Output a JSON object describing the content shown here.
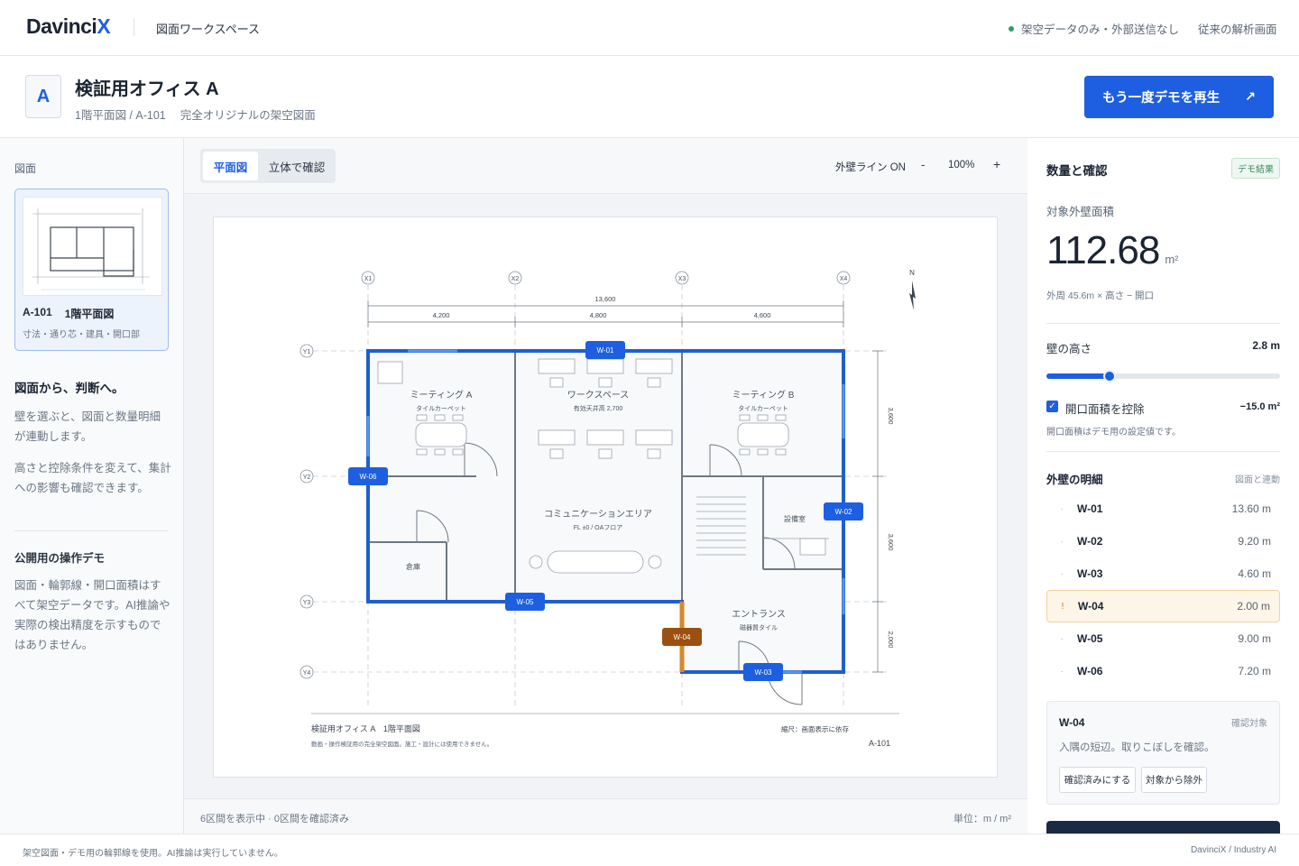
{
  "topbar": {
    "logo_main": "Davinci",
    "logo_accent": "X",
    "nav": "図面ワークスペース",
    "status": "架空データのみ・外部送信なし",
    "legacy_link": "従来の解析画面"
  },
  "header": {
    "icon_letter": "A",
    "title": "検証用オフィス A",
    "sheet": "1階平面図 / A-101",
    "note": "完全オリジナルの架空図面",
    "replay_button": "もう一度デモを再生",
    "replay_icon": "arrow-up-right-icon"
  },
  "left": {
    "section_label": "図面",
    "thumb": {
      "code": "A-101",
      "name": "1階平面図",
      "desc": "寸法・通り芯・建具・開口部"
    },
    "heading": "図面から、判断へ。",
    "para1": "壁を選ぶと、図面と数量明細が連動します。",
    "para2": "高さと控除条件を変えて、集計への影響も確認できます。",
    "heading2": "公開用の操作デモ",
    "para3": "図面・輪郭線・開口面積はすべて架空データです。AI推論や実際の検出精度を示すものではありません。"
  },
  "toolbar": {
    "tab_plan": "平面図",
    "tab_3d": "立体で確認",
    "wall_line": "外壁ライン ON",
    "zoom_minus": "-",
    "zoom": "100%",
    "zoom_plus": "+"
  },
  "drawing": {
    "grid_x": [
      "X1",
      "X2",
      "X3",
      "X4"
    ],
    "grid_y": [
      "Y1",
      "Y2",
      "Y3",
      "Y4"
    ],
    "dim_total": "13,600",
    "dims_x": [
      "4,200",
      "4,800",
      "4,600"
    ],
    "dims_y": [
      "3,600",
      "3,600",
      "2,000"
    ],
    "north": "N",
    "rooms": {
      "meeting_a": "ミーティング A",
      "meeting_a_sub": "タイルカーペット",
      "workspace": "ワークスペース",
      "workspace_sub": "有効天井高 2,700",
      "meeting_b": "ミーティング B",
      "meeting_b_sub": "タイルカーペット",
      "community": "コミュニケーションエリア",
      "community_sub": "FL ±0 / OAフロア",
      "equipment": "設備室",
      "storage": "倉庫",
      "entrance": "エントランス",
      "entrance_sub": "磁器質タイル"
    },
    "wall_tags": [
      "W-01",
      "W-02",
      "W-03",
      "W-04",
      "W-05",
      "W-06"
    ],
    "title_block": {
      "name": "検証用オフィス A　1階平面図",
      "disclaimer": "動画・操作検証用の完全架空図面。施工・設計には使用できません。",
      "scale": "縮尺：画面表示に依存",
      "sheet_no": "A-101"
    }
  },
  "center_footer": {
    "count": "6区間を表示中 · 0区間を確認済み",
    "unit": "単位：m / m²"
  },
  "right": {
    "title": "数量と確認",
    "badge": "デモ結果",
    "area_label": "対象外壁面積",
    "area_value": "112.68",
    "area_unit": "m²",
    "area_note": "外周 45.6m × 高さ − 開口",
    "height_label": "壁の高さ",
    "height_value": "2.8 m",
    "height_fraction": 0.27,
    "deduct_label": "開口面積を控除",
    "deduct_value": "−15.0 m²",
    "deduct_note": "開口面積はデモ用の設定値です。",
    "list_title": "外壁の明細",
    "list_link": "図面と連動",
    "walls": [
      {
        "id": "W-01",
        "length": "13.60 m"
      },
      {
        "id": "W-02",
        "length": "9.20 m"
      },
      {
        "id": "W-03",
        "length": "4.60 m"
      },
      {
        "id": "W-04",
        "length": "2.00 m",
        "flag": "!"
      },
      {
        "id": "W-05",
        "length": "9.00 m"
      },
      {
        "id": "W-06",
        "length": "7.20 m"
      }
    ],
    "detail": {
      "id": "W-04",
      "tag": "確認対象",
      "desc": "入隅の短辺。取りこぼしを確認。",
      "btn_confirm": "確認済みにする",
      "btn_exclude": "対象から除外"
    }
  },
  "footer": {
    "left": "架空図面・デモ用の輪郭線を使用。AI推論は実行していません。",
    "right": "DavinciX / Industry AI"
  },
  "colors": {
    "accent": "#1d5fe0",
    "warning": "#c9760f",
    "ok": "#2f9e6e"
  }
}
